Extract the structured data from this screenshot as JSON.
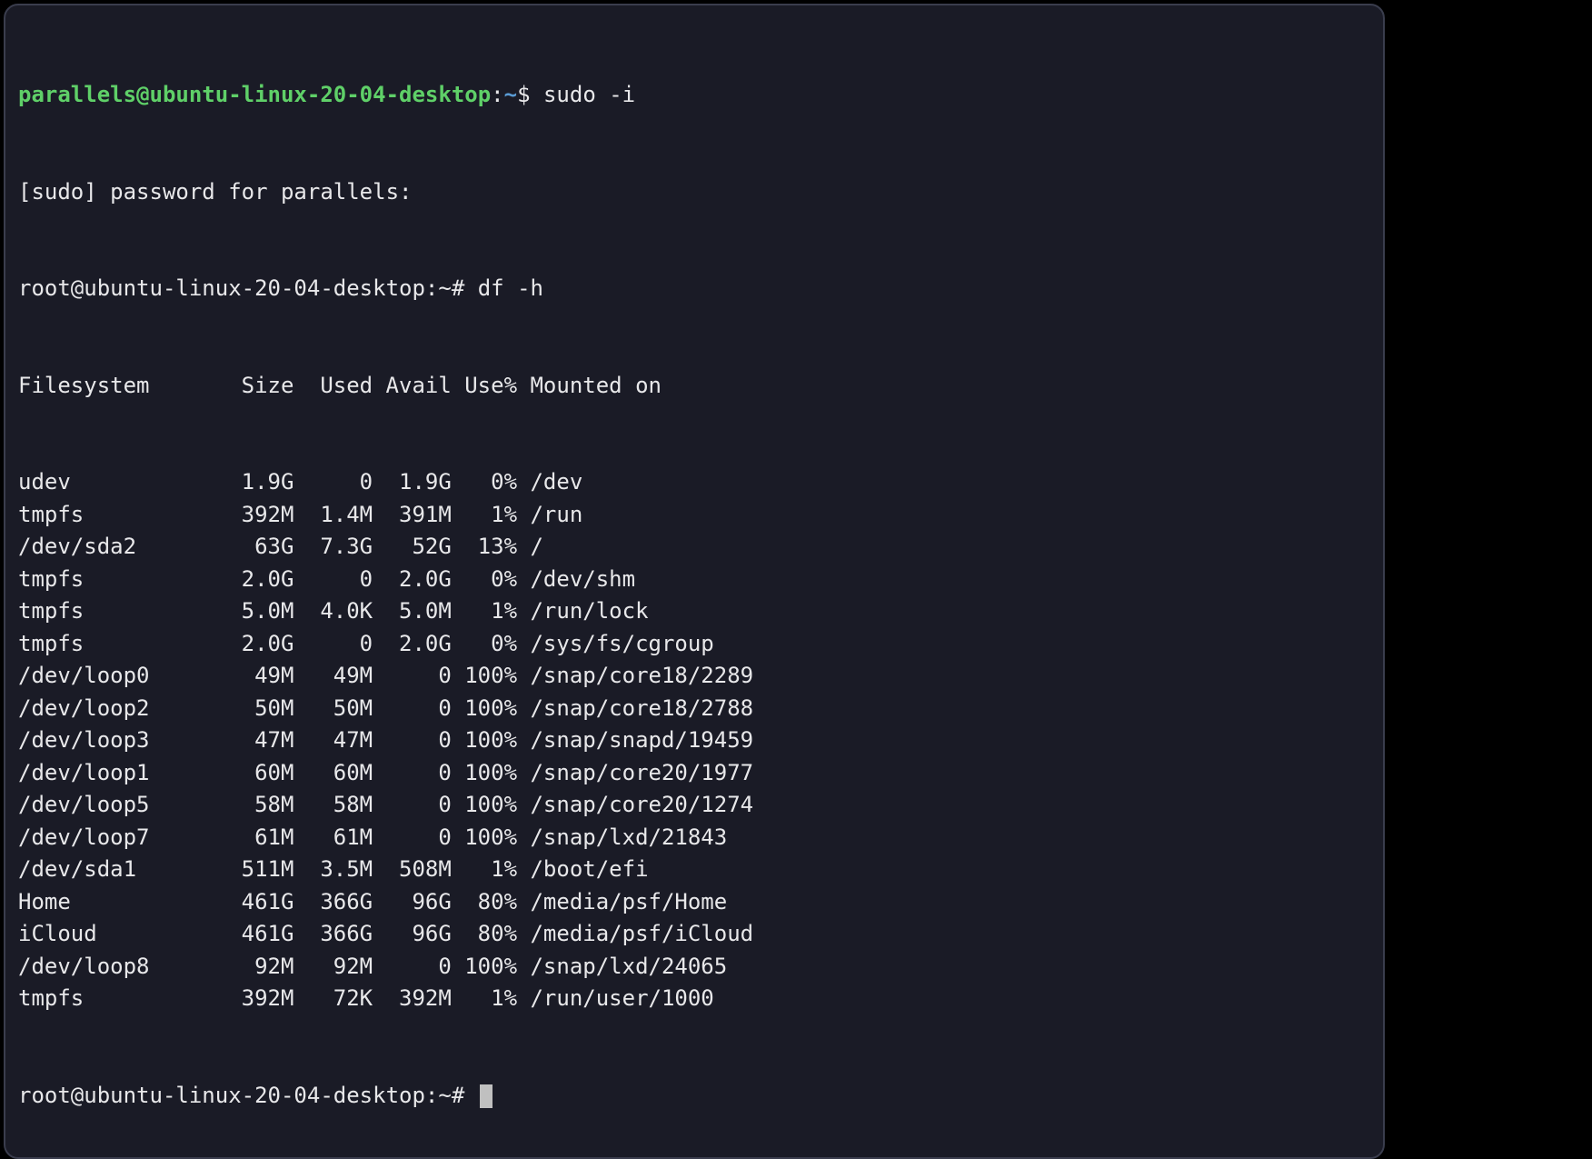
{
  "prompt1": {
    "user_host": "parallels@ubuntu-linux-20-04-desktop",
    "sep1": ":",
    "path": "~",
    "sym": "$",
    "command": "sudo -i"
  },
  "sudo_line": "[sudo] password for parallels:",
  "root_prompt1": {
    "text": "root@ubuntu-linux-20-04-desktop:~#",
    "command": "df -h"
  },
  "df": {
    "headers": {
      "fs": "Filesystem",
      "size": "Size",
      "used": "Used",
      "avail": "Avail",
      "usep": "Use%",
      "mnt": "Mounted on"
    },
    "rows": [
      {
        "fs": "udev",
        "size": "1.9G",
        "used": "0",
        "avail": "1.9G",
        "usep": "0%",
        "mnt": "/dev"
      },
      {
        "fs": "tmpfs",
        "size": "392M",
        "used": "1.4M",
        "avail": "391M",
        "usep": "1%",
        "mnt": "/run"
      },
      {
        "fs": "/dev/sda2",
        "size": "63G",
        "used": "7.3G",
        "avail": "52G",
        "usep": "13%",
        "mnt": "/"
      },
      {
        "fs": "tmpfs",
        "size": "2.0G",
        "used": "0",
        "avail": "2.0G",
        "usep": "0%",
        "mnt": "/dev/shm"
      },
      {
        "fs": "tmpfs",
        "size": "5.0M",
        "used": "4.0K",
        "avail": "5.0M",
        "usep": "1%",
        "mnt": "/run/lock"
      },
      {
        "fs": "tmpfs",
        "size": "2.0G",
        "used": "0",
        "avail": "2.0G",
        "usep": "0%",
        "mnt": "/sys/fs/cgroup"
      },
      {
        "fs": "/dev/loop0",
        "size": "49M",
        "used": "49M",
        "avail": "0",
        "usep": "100%",
        "mnt": "/snap/core18/2289"
      },
      {
        "fs": "/dev/loop2",
        "size": "50M",
        "used": "50M",
        "avail": "0",
        "usep": "100%",
        "mnt": "/snap/core18/2788"
      },
      {
        "fs": "/dev/loop3",
        "size": "47M",
        "used": "47M",
        "avail": "0",
        "usep": "100%",
        "mnt": "/snap/snapd/19459"
      },
      {
        "fs": "/dev/loop1",
        "size": "60M",
        "used": "60M",
        "avail": "0",
        "usep": "100%",
        "mnt": "/snap/core20/1977"
      },
      {
        "fs": "/dev/loop5",
        "size": "58M",
        "used": "58M",
        "avail": "0",
        "usep": "100%",
        "mnt": "/snap/core20/1274"
      },
      {
        "fs": "/dev/loop7",
        "size": "61M",
        "used": "61M",
        "avail": "0",
        "usep": "100%",
        "mnt": "/snap/lxd/21843"
      },
      {
        "fs": "/dev/sda1",
        "size": "511M",
        "used": "3.5M",
        "avail": "508M",
        "usep": "1%",
        "mnt": "/boot/efi"
      },
      {
        "fs": "Home",
        "size": "461G",
        "used": "366G",
        "avail": "96G",
        "usep": "80%",
        "mnt": "/media/psf/Home"
      },
      {
        "fs": "iCloud",
        "size": "461G",
        "used": "366G",
        "avail": "96G",
        "usep": "80%",
        "mnt": "/media/psf/iCloud"
      },
      {
        "fs": "/dev/loop8",
        "size": "92M",
        "used": "92M",
        "avail": "0",
        "usep": "100%",
        "mnt": "/snap/lxd/24065"
      },
      {
        "fs": "tmpfs",
        "size": "392M",
        "used": "72K",
        "avail": "392M",
        "usep": "1%",
        "mnt": "/run/user/1000"
      }
    ]
  },
  "root_prompt2": {
    "text": "root@ubuntu-linux-20-04-desktop:~#"
  }
}
